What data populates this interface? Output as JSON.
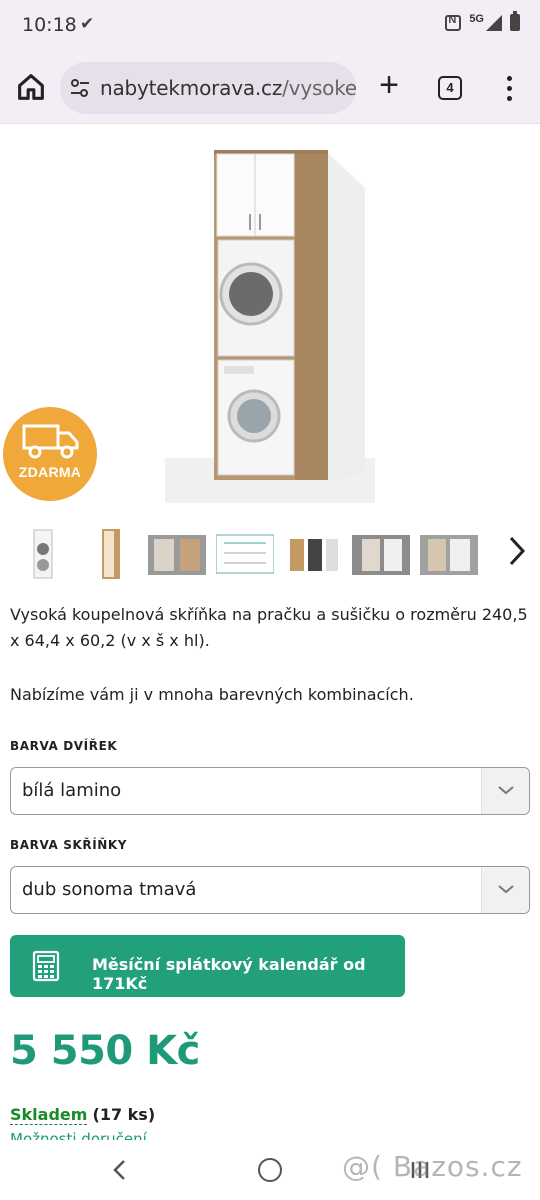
{
  "status_bar": {
    "time": "10:18",
    "network": "5G",
    "icons": [
      "check-icon",
      "nfc-icon",
      "signal-icon",
      "battery-icon"
    ]
  },
  "browser": {
    "url_main": "nabytekmorava.cz",
    "url_path": "/vysoke-k",
    "tab_count": "4",
    "icons": [
      "home-icon",
      "site-settings-icon",
      "plus-icon",
      "tabs-icon",
      "more-icon"
    ]
  },
  "product": {
    "badge_label": "ZDARMA",
    "thumbnail_count": 7,
    "description_1": "Vysoká koupelnová skříňka na pračku a sušičku o rozměru 240,5 x 64,4 x 60,2 (v x š x hl).",
    "description_2": "Nabízíme vám ji v mnoha barevných kombinacích.",
    "door_color_label": "BARVA DVÍŘEK",
    "door_color_value": "bílá lamino",
    "cabinet_color_label": "BARVA SKŘÍŇKY",
    "cabinet_color_value": "dub sonoma tmavá",
    "installment_button": "Měsíční splátkový kalendář od ",
    "installment_amount": "171Kč",
    "price": "5 550 Kč",
    "stock_status": "Skladem",
    "stock_count": "(17 ks)",
    "delivery_options": "Možnosti doručení"
  },
  "watermark": "@( Bazos.cz",
  "colors": {
    "accent_green": "#22a07c",
    "price_green": "#1f9a78",
    "stock_green": "#1a8a2a",
    "badge_orange": "#f0a83a",
    "chrome_bg": "#f3eef6"
  }
}
